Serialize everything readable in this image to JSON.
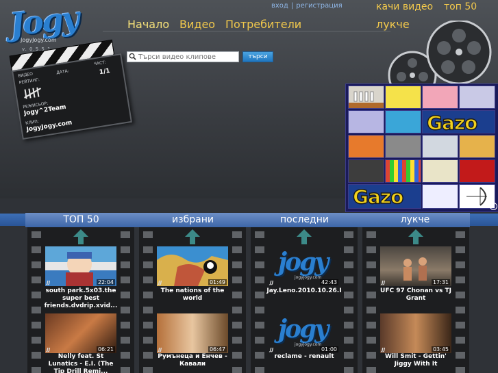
{
  "site": {
    "name": "JogyJogy.com",
    "version": "v. 0.5.5.1"
  },
  "auth": {
    "login": "вход",
    "separator": "|",
    "register": "регистрация"
  },
  "topnav": {
    "upload": "качи видео",
    "top50": "топ 50",
    "funny": "лукче"
  },
  "nav": {
    "home": "Начало",
    "video": "Видео",
    "users": "Потребители"
  },
  "search": {
    "placeholder": "Търси видео клипове",
    "button": "търси"
  },
  "clapper": {
    "video_label": "ВИДЕО",
    "rating_label": "РЕЙТИНГ:",
    "date_label": "ДАТА:",
    "part_label": "ЧАСТ:",
    "part_value": "1/1",
    "director_label": "РЕЖИСЬОР:",
    "director_value": "Jogy^2Team",
    "clip_label": "КЛИП:",
    "clip_value": "JogyJogy.com"
  },
  "ad": {
    "brand_1": "Gazo",
    "brand_2": "Gazo",
    "info": "i"
  },
  "columns": [
    {
      "title": "ТОП 50",
      "videos": [
        {
          "title": "south park.5x03.the super best friends.dvdrip.xvid...",
          "duration": "22:04"
        },
        {
          "title": "Nelly feat. St Lunatics - E.I. (The Tip Drill Remi...",
          "duration": "06:21"
        }
      ]
    },
    {
      "title": "избрани",
      "videos": [
        {
          "title": "The nations of the world",
          "duration": "01:49"
        },
        {
          "title": "Румънеца и Енчев - Кавали",
          "duration": "06:47"
        }
      ]
    },
    {
      "title": "последни",
      "videos": [
        {
          "title": "Jay.Leno.2010.10.26.I",
          "duration": "42:43",
          "logo": "jogy",
          "logo_site": "jogyjogy.com"
        },
        {
          "title": "reclame - renault",
          "duration": "01:00",
          "logo": "jogy",
          "logo_site": "jogyjogy.com"
        }
      ]
    },
    {
      "title": "лукче",
      "videos": [
        {
          "title": "UFC 97 Chonan vs TJ Grant",
          "duration": "17:31"
        },
        {
          "title": "Will Smit - Gettin' Jiggy With It",
          "duration": "03:45"
        }
      ]
    }
  ],
  "mini_logo": "JJ",
  "colors": {
    "accent_nav": "#f2c94c",
    "link_blue": "#8fb7e8",
    "brand_blue": "#2a7fd0",
    "column_header": "#3d66a8"
  }
}
